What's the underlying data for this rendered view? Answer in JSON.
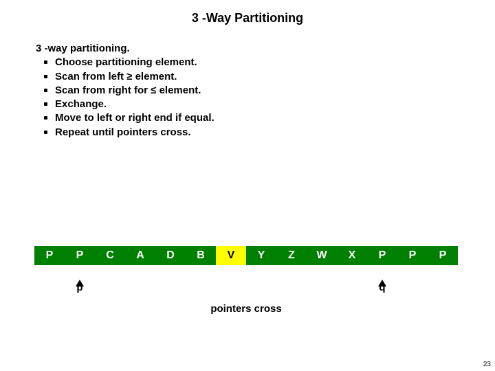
{
  "title": "3 -Way Partitioning",
  "subheading": "3 -way partitioning.",
  "bullets": [
    "Choose partitioning element.",
    "Scan from left ≥ element.",
    "Scan from right for ≤  element.",
    "Exchange.",
    "Move to left or right end if equal.",
    "Repeat until pointers cross."
  ],
  "array": {
    "cells": [
      {
        "value": "P",
        "color": "green"
      },
      {
        "value": "P",
        "color": "green"
      },
      {
        "value": "C",
        "color": "green"
      },
      {
        "value": "A",
        "color": "green"
      },
      {
        "value": "D",
        "color": "green"
      },
      {
        "value": "B",
        "color": "green"
      },
      {
        "value": "V",
        "color": "yellow"
      },
      {
        "value": "Y",
        "color": "green"
      },
      {
        "value": "Z",
        "color": "green"
      },
      {
        "value": "W",
        "color": "green"
      },
      {
        "value": "X",
        "color": "green"
      },
      {
        "value": "P",
        "color": "green"
      },
      {
        "value": "P",
        "color": "green"
      },
      {
        "value": "P",
        "color": "green"
      }
    ]
  },
  "pointers": {
    "p": {
      "label": "p",
      "index": 1
    },
    "q": {
      "label": "q",
      "index": 11
    }
  },
  "caption": "pointers cross",
  "page_number": "23",
  "colors": {
    "green": "#008000",
    "yellow": "#ffff00"
  }
}
